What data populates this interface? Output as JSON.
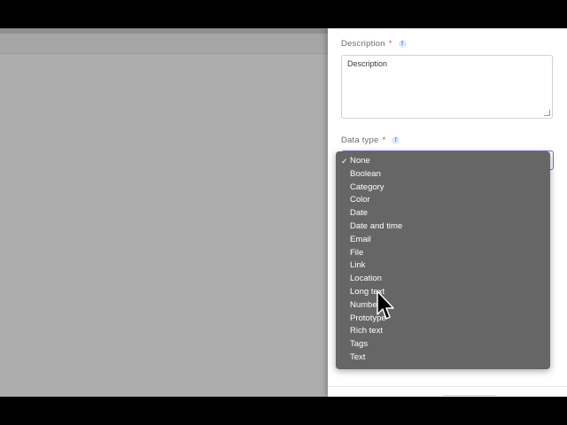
{
  "panel": {
    "description": {
      "label": "Description",
      "required_mark": "*",
      "info": "!",
      "value": "Description"
    },
    "data_type": {
      "label": "Data type",
      "required_mark": "*",
      "info": "!",
      "selected": "None"
    }
  },
  "dropdown": {
    "check_mark": "✓",
    "options": [
      "None",
      "Boolean",
      "Category",
      "Color",
      "Date",
      "Date and time",
      "Email",
      "File",
      "Link",
      "Location",
      "Long text",
      "Number",
      "Prototype",
      "Rich text",
      "Tags",
      "Text"
    ]
  },
  "colors": {
    "accent_border": "#7a6bd6",
    "dropdown_bg": "#666666",
    "required": "#e0474c"
  },
  "icons": {
    "cursor": "mouse-pointer-icon",
    "info": "info-icon",
    "check": "check-icon"
  }
}
